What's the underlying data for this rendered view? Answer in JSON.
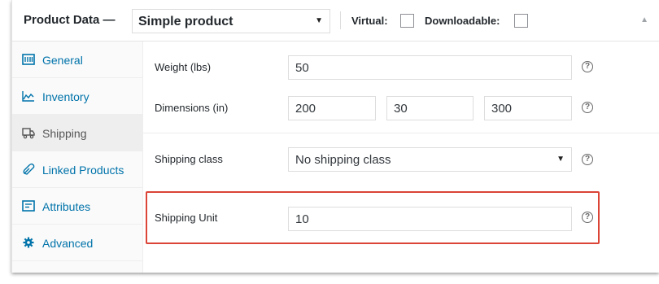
{
  "header": {
    "title": "Product Data —",
    "product_type": "Simple product",
    "virtual_label": "Virtual:",
    "downloadable_label": "Downloadable:"
  },
  "sidebar": {
    "items": [
      {
        "label": "General",
        "icon": "general-icon",
        "active": false
      },
      {
        "label": "Inventory",
        "icon": "inventory-icon",
        "active": false
      },
      {
        "label": "Shipping",
        "icon": "truck-icon",
        "active": true
      },
      {
        "label": "Linked Products",
        "icon": "link-icon",
        "active": false
      },
      {
        "label": "Attributes",
        "icon": "attributes-icon",
        "active": false
      },
      {
        "label": "Advanced",
        "icon": "gear-icon",
        "active": false
      }
    ]
  },
  "shipping": {
    "weight_label": "Weight (lbs)",
    "weight_value": "50",
    "dimensions_label": "Dimensions (in)",
    "length_value": "200",
    "width_value": "30",
    "height_value": "300",
    "class_label": "Shipping class",
    "class_value": "No shipping class",
    "unit_label": "Shipping Unit",
    "unit_value": "10"
  },
  "help_glyph": "?",
  "colors": {
    "link": "#0073aa",
    "highlight": "#db4437",
    "active_tab_bg": "#eeeeee"
  }
}
